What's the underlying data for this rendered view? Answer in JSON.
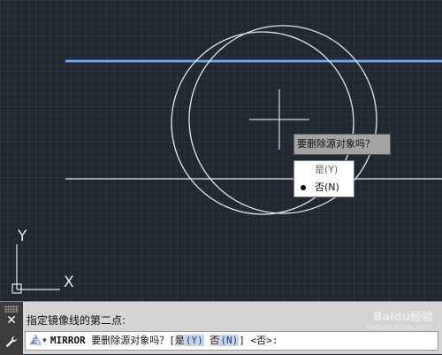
{
  "prompt": {
    "question": "要删除源对象吗？"
  },
  "options": [
    {
      "label": "是(Y)",
      "selected": false
    },
    {
      "label": "否(N)",
      "selected": true
    }
  ],
  "ucs": {
    "y_label": "Y",
    "x_label": "X"
  },
  "command_line": {
    "history": "指定镜像线的第二点:",
    "command_name": "MIRROR",
    "question": "要删除源对象吗？",
    "bracket_open": "[",
    "option_yes_text": "是",
    "option_yes_key": "(Y)",
    "option_no_text": "否",
    "option_no_key": "(N)",
    "bracket_close": "]",
    "default_value": "<否>:",
    "close_icon": "close-icon",
    "settings_icon": "wrench-icon",
    "command_icon": "mirror-command-icon"
  },
  "watermark": {
    "brand": "Baidu经验",
    "url": "jingyan.baidu.com"
  },
  "colors": {
    "canvas_bg": "#212830",
    "mirror_line": "#4f86e8",
    "geometry": "#e6e6e6"
  }
}
